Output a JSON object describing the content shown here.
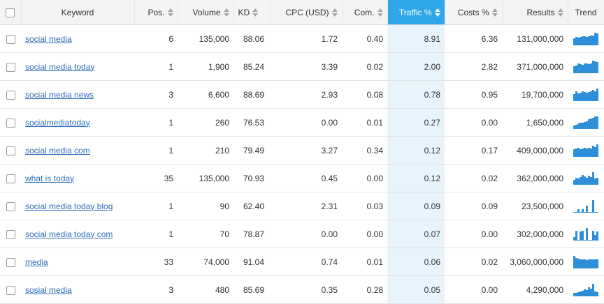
{
  "table": {
    "headers": {
      "keyword": "Keyword",
      "pos": "Pos.",
      "volume": "Volume",
      "kd": "KD",
      "cpc": "CPC (USD)",
      "com": "Com.",
      "traffic": "Traffic %",
      "costs": "Costs %",
      "results": "Results",
      "trend": "Trend"
    },
    "sorted_column": "traffic",
    "accent_color": "#2ea7e8",
    "trend_color": "#2e8fd8",
    "rows": [
      {
        "keyword": "social media",
        "pos": "6",
        "volume": "135,000",
        "kd": "88.06",
        "cpc": "1.72",
        "com": "0.40",
        "traffic": "8.91",
        "costs": "6.36",
        "results": "131,000,000",
        "trend": [
          0.55,
          0.65,
          0.6,
          0.65,
          0.7,
          0.7,
          0.65,
          0.7,
          0.75,
          0.75,
          1.0,
          0.95
        ]
      },
      {
        "keyword": "social media today",
        "pos": "1",
        "volume": "1,900",
        "kd": "85.24",
        "cpc": "3.39",
        "com": "0.02",
        "traffic": "2.00",
        "costs": "2.82",
        "results": "371,000,000",
        "trend": [
          0.55,
          0.6,
          0.75,
          0.7,
          0.65,
          0.8,
          0.75,
          0.7,
          0.75,
          1.0,
          0.95,
          0.9
        ]
      },
      {
        "keyword": "social media news",
        "pos": "3",
        "volume": "6,600",
        "kd": "88.69",
        "cpc": "2.93",
        "com": "0.08",
        "traffic": "0.78",
        "costs": "0.95",
        "results": "19,700,000",
        "trend": [
          0.55,
          0.75,
          0.6,
          0.65,
          0.8,
          0.7,
          0.65,
          0.7,
          0.75,
          0.9,
          0.8,
          1.0
        ]
      },
      {
        "keyword": "socialmediatoday",
        "pos": "1",
        "volume": "260",
        "kd": "76.53",
        "cpc": "0.00",
        "com": "0.01",
        "traffic": "0.27",
        "costs": "0.00",
        "results": "1,650,000",
        "trend": [
          0.25,
          0.35,
          0.45,
          0.5,
          0.5,
          0.55,
          0.6,
          0.75,
          0.85,
          0.9,
          1.0,
          1.0
        ]
      },
      {
        "keyword": "social media com",
        "pos": "1",
        "volume": "210",
        "kd": "79.49",
        "cpc": "3.27",
        "com": "0.34",
        "traffic": "0.12",
        "costs": "0.17",
        "results": "409,000,000",
        "trend": [
          0.6,
          0.65,
          0.7,
          0.6,
          0.65,
          0.7,
          0.65,
          0.7,
          0.65,
          0.9,
          0.75,
          1.0
        ]
      },
      {
        "keyword": "what is today",
        "pos": "35",
        "volume": "135,000",
        "kd": "70.93",
        "cpc": "0.45",
        "com": "0.00",
        "traffic": "0.12",
        "costs": "0.02",
        "results": "362,000,000",
        "trend": [
          0.4,
          0.55,
          0.5,
          0.6,
          0.75,
          0.65,
          0.55,
          0.7,
          0.6,
          1.0,
          0.5,
          0.55
        ]
      },
      {
        "keyword": "social media today blog",
        "pos": "1",
        "volume": "90",
        "kd": "62.40",
        "cpc": "2.31",
        "com": "0.03",
        "traffic": "0.09",
        "costs": "0.09",
        "results": "23,500,000",
        "trend": [
          0.05,
          0.05,
          0.25,
          0.05,
          0.3,
          0.05,
          0.55,
          0.05,
          0.05,
          1.0,
          0.05,
          0.05
        ]
      },
      {
        "keyword": "social media today com",
        "pos": "1",
        "volume": "70",
        "kd": "78.87",
        "cpc": "0.00",
        "com": "0.00",
        "traffic": "0.07",
        "costs": "0.00",
        "results": "302,000,000",
        "trend": [
          0.3,
          0.75,
          0.05,
          0.7,
          0.8,
          0.05,
          1.0,
          0.05,
          0.05,
          0.75,
          0.45,
          0.7
        ]
      },
      {
        "keyword": "media",
        "pos": "33",
        "volume": "74,000",
        "kd": "91.04",
        "cpc": "0.74",
        "com": "0.01",
        "traffic": "0.06",
        "costs": "0.02",
        "results": "3,060,000,000",
        "trend": [
          1.0,
          0.85,
          0.75,
          0.7,
          0.72,
          0.7,
          0.68,
          0.7,
          0.72,
          0.7,
          0.72,
          0.7
        ]
      },
      {
        "keyword": "sosial media",
        "pos": "3",
        "volume": "480",
        "kd": "85.69",
        "cpc": "0.35",
        "com": "0.28",
        "traffic": "0.05",
        "costs": "0.00",
        "results": "4,290,000",
        "trend": [
          0.25,
          0.3,
          0.35,
          0.4,
          0.45,
          0.55,
          0.5,
          0.7,
          0.6,
          1.0,
          0.4,
          0.35
        ]
      }
    ]
  }
}
